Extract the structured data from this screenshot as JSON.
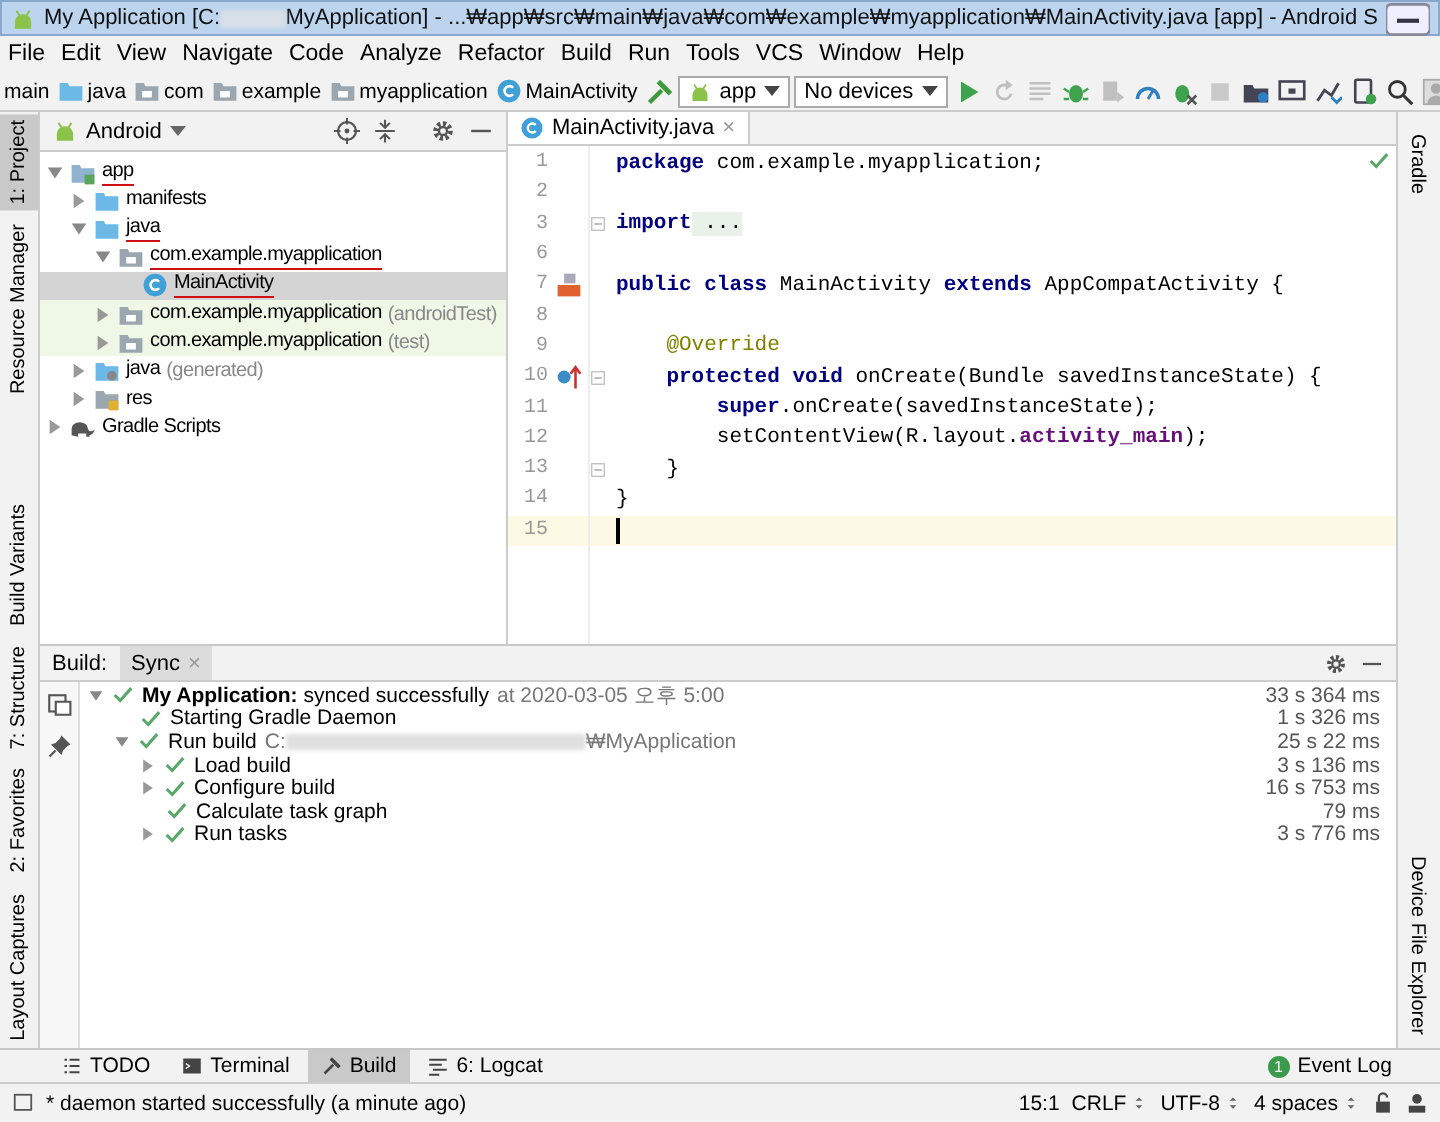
{
  "window": {
    "title_start": "My Application [C:",
    "title_end": "MyApplication] - ...₩app₩src₩main₩java₩com₩example₩myapplication₩MainActivity.java [app] - Android S"
  },
  "menu": [
    "File",
    "Edit",
    "View",
    "Navigate",
    "Code",
    "Analyze",
    "Refactor",
    "Build",
    "Run",
    "Tools",
    "VCS",
    "Window",
    "Help"
  ],
  "breadcrumbs": [
    {
      "label": "main",
      "kind": "module"
    },
    {
      "label": "java",
      "kind": "folder"
    },
    {
      "label": "com",
      "kind": "package"
    },
    {
      "label": "example",
      "kind": "package"
    },
    {
      "label": "myapplication",
      "kind": "package"
    },
    {
      "label": "MainActivity",
      "kind": "class"
    }
  ],
  "toolbar": {
    "run_config": "app",
    "device": "No devices",
    "icons": [
      {
        "kind": "run",
        "disabled": false
      },
      {
        "kind": "rerun",
        "disabled": true
      },
      {
        "kind": "coverage",
        "disabled": true
      },
      {
        "kind": "debug",
        "disabled": false
      },
      {
        "kind": "attach",
        "disabled": true
      },
      {
        "kind": "profile",
        "disabled": false
      },
      {
        "kind": "apply",
        "disabled": false
      },
      {
        "kind": "stop",
        "disabled": true
      },
      {
        "kind": "sync",
        "disabled": false
      },
      {
        "kind": "avd",
        "disabled": false
      },
      {
        "kind": "sdk",
        "disabled": false
      },
      {
        "kind": "device",
        "disabled": false
      },
      {
        "kind": "search",
        "disabled": false
      },
      {
        "kind": "user",
        "disabled": false
      }
    ]
  },
  "left_strip": {
    "top": [
      {
        "label": "1: Project",
        "selected": true
      },
      {
        "label": "Resource Manager",
        "selected": false
      }
    ],
    "bottom": [
      {
        "label": "Build Variants",
        "selected": false
      },
      {
        "label": "7: Structure",
        "selected": false
      },
      {
        "label": "2: Favorites",
        "selected": false
      },
      {
        "label": "Layout Captures",
        "selected": false
      }
    ]
  },
  "right_strip": {
    "top": [
      {
        "label": "Gradle",
        "selected": false
      }
    ],
    "bottom": [
      {
        "label": "Device File Explorer",
        "selected": false
      }
    ]
  },
  "project": {
    "view": "Android",
    "tree": [
      {
        "label": "app",
        "kind": "module",
        "expanded": true,
        "selected": false,
        "underlined": true,
        "children": [
          {
            "label": "manifests",
            "kind": "folder",
            "expanded": false,
            "selected": false,
            "underlined": false
          },
          {
            "label": "java",
            "kind": "folder",
            "expanded": true,
            "selected": false,
            "underlined": true,
            "children": [
              {
                "label": "com.example.myapplication",
                "kind": "package",
                "expanded": true,
                "selected": false,
                "underlined": true,
                "children": [
                  {
                    "label": "MainActivity",
                    "kind": "class",
                    "selected": true,
                    "underlined": true
                  }
                ]
              },
              {
                "label": "com.example.myapplication",
                "suffix": "(androidTest)",
                "kind": "test-package",
                "expanded": false,
                "selected": false,
                "underlined": false
              },
              {
                "label": "com.example.myapplication",
                "suffix": "(test)",
                "kind": "test-package",
                "expanded": false,
                "selected": false,
                "underlined": false
              }
            ]
          },
          {
            "label": "java",
            "suffix": "(generated)",
            "kind": "generated",
            "expanded": false,
            "selected": false,
            "underlined": false
          },
          {
            "label": "res",
            "kind": "res",
            "expanded": false,
            "selected": false,
            "underlined": false
          }
        ]
      },
      {
        "label": "Gradle Scripts",
        "kind": "gradle",
        "expanded": false,
        "selected": false,
        "underlined": false
      }
    ]
  },
  "editor": {
    "tabs": [
      {
        "label": "MainActivity.java",
        "close": "×",
        "selected": true
      }
    ],
    "lines": [
      {
        "number": "1",
        "kind": "plain",
        "current": false,
        "tokens": [
          {
            "kind": "keyword",
            "text": "package"
          },
          {
            "kind": "plain",
            "text": " com.example.myapplication;"
          }
        ]
      },
      {
        "number": "2",
        "kind": "plain",
        "current": false
      },
      {
        "number": "3",
        "kind": "plain",
        "current": false,
        "fold": true,
        "tokens": [
          {
            "kind": "keyword",
            "text": "import"
          },
          {
            "kind": "folded",
            "text": " ..."
          }
        ]
      },
      {
        "number": "6",
        "kind": "plain",
        "current": false
      },
      {
        "number": "7",
        "kind": "layout-marker",
        "current": false,
        "tokens": [
          {
            "kind": "keyword",
            "text": "public class"
          },
          {
            "kind": "plain",
            "text": " MainActivity "
          },
          {
            "kind": "keyword",
            "text": "extends"
          },
          {
            "kind": "plain",
            "text": " AppCompatActivity {"
          }
        ]
      },
      {
        "number": "8",
        "kind": "plain",
        "current": false
      },
      {
        "number": "9",
        "kind": "plain",
        "current": false,
        "tokens": [
          {
            "kind": "annotation",
            "text": "    @Override"
          }
        ]
      },
      {
        "number": "10",
        "kind": "override-marker",
        "current": false,
        "fold": true,
        "tokens": [
          {
            "kind": "keyword",
            "text": "    protected void"
          },
          {
            "kind": "plain",
            "text": " onCreate(Bundle savedInstanceState) {"
          }
        ]
      },
      {
        "number": "11",
        "kind": "plain",
        "current": false,
        "tokens": [
          {
            "kind": "keyword",
            "text": "        super"
          },
          {
            "kind": "plain",
            "text": ".onCreate(savedInstanceState);"
          }
        ]
      },
      {
        "number": "12",
        "kind": "plain",
        "current": false,
        "tokens": [
          {
            "kind": "plain",
            "text": "        setContentView(R.layout."
          },
          {
            "kind": "field",
            "text": "activity_main"
          },
          {
            "kind": "plain",
            "text": ");"
          }
        ]
      },
      {
        "number": "13",
        "kind": "plain",
        "current": false,
        "fold": true,
        "tokens": [
          {
            "kind": "plain",
            "text": "    }"
          }
        ]
      },
      {
        "number": "14",
        "kind": "plain",
        "current": false,
        "tokens": [
          {
            "kind": "plain",
            "text": "}"
          }
        ]
      },
      {
        "number": "15",
        "kind": "plain",
        "current": true
      }
    ]
  },
  "build": {
    "label": "Build:",
    "tabs": [
      {
        "label": "Sync",
        "close": "×",
        "selected": true
      }
    ],
    "tree": [
      {
        "label": "**My Application:** synced successfully",
        "detail": "at 2020-03-05 오후 5:00",
        "time": "33 s 364 ms",
        "succeeded": true,
        "expanded": true,
        "children": [
          {
            "label": "Starting Gradle Daemon",
            "time": "1 s 326 ms",
            "succeeded": true
          },
          {
            "label": "Run build",
            "detail": "C:",
            "detail_after": "₩MyApplication",
            "time": "25 s 22 ms",
            "succeeded": true,
            "expanded": true,
            "children": [
              {
                "label": "Load build",
                "time": "3 s 136 ms",
                "succeeded": true,
                "expanded": false
              },
              {
                "label": "Configure build",
                "time": "16 s 753 ms",
                "succeeded": true,
                "expanded": false
              },
              {
                "label": "Calculate task graph",
                "time": "79 ms",
                "succeeded": true
              },
              {
                "label": "Run tasks",
                "time": "3 s 776 ms",
                "succeeded": true,
                "expanded": false
              }
            ]
          }
        ]
      }
    ]
  },
  "bottom_tabs": [
    {
      "label": "TODO",
      "kind": "todo",
      "selected": false
    },
    {
      "label": "Terminal",
      "kind": "terminal",
      "selected": false
    },
    {
      "label": "Build",
      "kind": "build",
      "selected": true
    },
    {
      "label": "6: Logcat",
      "kind": "logcat",
      "selected": false
    }
  ],
  "event_log": {
    "label": "Event Log",
    "count": "1"
  },
  "status_bar": {
    "message": "* daemon started successfully (a minute ago)",
    "position": "15:1",
    "line_separator": "CRLF",
    "encoding": "UTF-8",
    "indent": "4 spaces"
  }
}
